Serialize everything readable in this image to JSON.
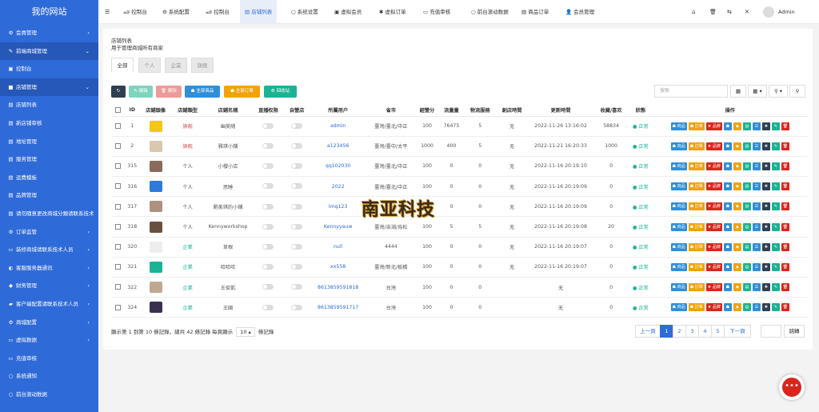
{
  "brand": "我的网站",
  "sidebar": [
    {
      "icon": "⚙",
      "label": "会員管理",
      "arrow": "‹",
      "active": false
    },
    {
      "icon": "✎",
      "label": "前端商城管理",
      "arrow": "⌄",
      "active": true
    },
    {
      "icon": "▣",
      "label": "控制台",
      "arrow": "",
      "active": false
    },
    {
      "icon": "■",
      "label": "店铺管理",
      "arrow": "⌄",
      "active": true
    },
    {
      "icon": "▤",
      "label": "店铺列表",
      "arrow": "",
      "active": false
    },
    {
      "icon": "▤",
      "label": "新店铺审核",
      "arrow": "",
      "active": false
    },
    {
      "icon": "▤",
      "label": "地址管理",
      "arrow": "",
      "active": false
    },
    {
      "icon": "▤",
      "label": "服务管理",
      "arrow": "",
      "active": false
    },
    {
      "icon": "▤",
      "label": "运费模板",
      "arrow": "",
      "active": false
    },
    {
      "icon": "▤",
      "label": "品牌管理",
      "arrow": "",
      "active": false
    },
    {
      "icon": "▤",
      "label": "请勿隨意更改商城分類请联系技术",
      "arrow": "",
      "active": false
    },
    {
      "icon": "⚙",
      "label": "订单监管",
      "arrow": "‹",
      "active": false
    },
    {
      "icon": "▭",
      "label": "装修商城请联系技术人员",
      "arrow": "‹",
      "active": false
    },
    {
      "icon": "◐",
      "label": "客服服务器通讯",
      "arrow": "‹",
      "active": false
    },
    {
      "icon": "◆",
      "label": "财务管理",
      "arrow": "‹",
      "active": false
    },
    {
      "icon": "▰",
      "label": "客户端配置请联系技术人员",
      "arrow": "‹",
      "active": false
    },
    {
      "icon": "⚙",
      "label": "商城配置",
      "arrow": "‹",
      "active": false
    },
    {
      "icon": "▭",
      "label": "虚拟数据",
      "arrow": "‹",
      "active": false
    },
    {
      "icon": "▭",
      "label": "充值审核",
      "arrow": "",
      "active": false
    },
    {
      "icon": "○",
      "label": "系统通知",
      "arrow": "",
      "active": false
    },
    {
      "icon": "○",
      "label": "前台滚动数据",
      "arrow": "",
      "active": false
    }
  ],
  "topnav": {
    "menu_icon": "☰",
    "tabs": [
      {
        "icon": "🏎",
        "label": "控制台"
      },
      {
        "icon": "⚙",
        "label": "系统配置"
      },
      {
        "icon": "🏎",
        "label": "控制台"
      },
      {
        "icon": "▤",
        "label": "店铺列表"
      },
      {
        "icon": "○",
        "label": "系统设置"
      },
      {
        "icon": "▣",
        "label": "虚拟会员"
      },
      {
        "icon": "✱",
        "label": "虚拟订单"
      },
      {
        "icon": "▭",
        "label": "充值审核"
      },
      {
        "icon": "○",
        "label": "前台滚动数据"
      },
      {
        "icon": "▤",
        "label": "商品订单"
      },
      {
        "icon": "👤",
        "label": "会员管理"
      }
    ],
    "right_icons": [
      "⌂",
      "🗑",
      "⇆",
      "✕"
    ],
    "user": "Admin"
  },
  "page": {
    "title": "店铺列表",
    "subtitle": "用于管理商城所有商家",
    "filter_tabs": [
      "全部",
      "个人",
      "企業",
      "旗舰"
    ],
    "toolbar": {
      "refresh": "↻",
      "edit": "✎ 编辑",
      "delete": "🗑 删除",
      "all_goods": "☗ 全部商品",
      "all_orders": "☗ 全部订單",
      "recycle": "♻ 回收站"
    },
    "search_placeholder": "搜索",
    "right_btns": [
      "▦",
      "▦ ▾",
      "⚲ ▾",
      "⚲"
    ]
  },
  "table": {
    "headers": [
      "",
      "ID",
      "店鋪頭像",
      "店鋪類型",
      "店鋪名稱",
      "直播权限",
      "自營店",
      "所屬用户",
      "省市",
      "經營分",
      "流量量",
      "物流服務",
      "創店時間",
      "更新時間",
      "收藏/喜欢",
      "狀態",
      "操作"
    ],
    "rows": [
      {
        "id": "1",
        "avatar": "#f5c518",
        "type": "旗舰",
        "type_c": "rd",
        "name": "幽美随",
        "user": "admin",
        "region": "臺灣/臺北/中正",
        "score": "100",
        "traffic": "76475",
        "logistics": "5",
        "created": "无",
        "updated": "2022-11-26 13:16:02",
        "fav": "58834",
        "status": "● 正常"
      },
      {
        "id": "2",
        "avatar": "#d8c8b0",
        "type": "旗舰",
        "type_c": "rd",
        "name": "雅琪小鋪",
        "user": "a123456",
        "region": "臺灣/臺中/太平",
        "score": "1000",
        "traffic": "400",
        "logistics": "5",
        "created": "无",
        "updated": "2022-11-21 16:20:33",
        "fav": "1000",
        "status": "● 正常"
      },
      {
        "id": "315",
        "avatar": "#8a6a5a",
        "type": "个人",
        "type_c": "",
        "name": "小櫻小店",
        "user": "qq102030",
        "region": "臺灣/臺北/中正",
        "score": "100",
        "traffic": "0",
        "logistics": "0",
        "created": "无",
        "updated": "2022-11-16 20:19:10",
        "fav": "0",
        "status": "● 正常"
      },
      {
        "id": "316",
        "avatar": "#2f7ad9",
        "type": "个人",
        "type_c": "",
        "name": "思睡",
        "user": "2022",
        "region": "臺灣/臺北/中正",
        "score": "100",
        "traffic": "0",
        "logistics": "0",
        "created": "无",
        "updated": "2022-11-16 20:19:09",
        "fav": "0",
        "status": "● 正常"
      },
      {
        "id": "317",
        "avatar": "#b09080",
        "type": "个人",
        "type_c": "",
        "name": "劉美琪的小鋪",
        "user": "lmq123",
        "region": "",
        "score": "100",
        "traffic": "0",
        "logistics": "0",
        "created": "无",
        "updated": "2022-11-16 20:19:09",
        "fav": "0",
        "status": "● 正常"
      },
      {
        "id": "318",
        "avatar": "#6a5040",
        "type": "个人",
        "type_c": "",
        "name": "Kennyworkshop",
        "user": "Kennyyauw",
        "region": "臺灣/澎湖/烏松",
        "score": "100",
        "traffic": "5",
        "logistics": "5",
        "created": "无",
        "updated": "2022-11-16 20:19:08",
        "fav": "20",
        "status": "● 正常"
      },
      {
        "id": "320",
        "avatar": "#eeeeee",
        "type": "企業",
        "type_c": "gn",
        "name": "草根",
        "user": "null",
        "region": "4444",
        "score": "100",
        "traffic": "0",
        "logistics": "0",
        "created": "无",
        "updated": "2022-11-16 20:19:07",
        "fav": "0",
        "status": "● 正常"
      },
      {
        "id": "321",
        "avatar": "#1ab394",
        "type": "企業",
        "type_c": "gn",
        "name": "哈哈哈",
        "user": "xx558",
        "region": "臺灣/新北/板橋",
        "score": "100",
        "traffic": "0",
        "logistics": "0",
        "created": "无",
        "updated": "2022-11-16 20:19:07",
        "fav": "0",
        "status": "● 正常"
      },
      {
        "id": "322",
        "avatar": "#c0a890",
        "type": "企業",
        "type_c": "gn",
        "name": "王俊凱",
        "user": "8613859591818",
        "region": "台灣",
        "score": "100",
        "traffic": "0",
        "logistics": "0",
        "created": "",
        "updated": "无",
        "fav": "0",
        "status": "● 正常"
      },
      {
        "id": "324",
        "avatar": "#3a3050",
        "type": "企業",
        "type_c": "gn",
        "name": "王國",
        "user": "8613859591717",
        "region": "台灣",
        "score": "100",
        "traffic": "0",
        "logistics": "0",
        "created": "",
        "updated": "无",
        "fav": "0",
        "status": "● 正常"
      }
    ],
    "ops": {
      "goods": "☗ 商品",
      "orders": "☗ 訂單",
      "brand": "★ 品牌",
      "icons": [
        "☗",
        "◆",
        "▤",
        "☰",
        "✚",
        "✎",
        "🗑"
      ]
    }
  },
  "footer": {
    "prefix": "顯示第 1 到第 10 條記錄，總共 42 條記錄 每頁顯示",
    "per_page": "10 ▴",
    "suffix": "條記錄"
  },
  "pager": {
    "prev": "上一頁",
    "pages": [
      "1",
      "2",
      "3",
      "4",
      "5"
    ],
    "next": "下一頁",
    "goto": "跳轉"
  },
  "watermark": "南亚科技",
  "chat_icon": "•••",
  "colors": {
    "primary": "#2f6ad9",
    "green": "#1ab394",
    "red": "#d9534f",
    "orange": "#f0a30a",
    "dark": "#2f4050"
  }
}
